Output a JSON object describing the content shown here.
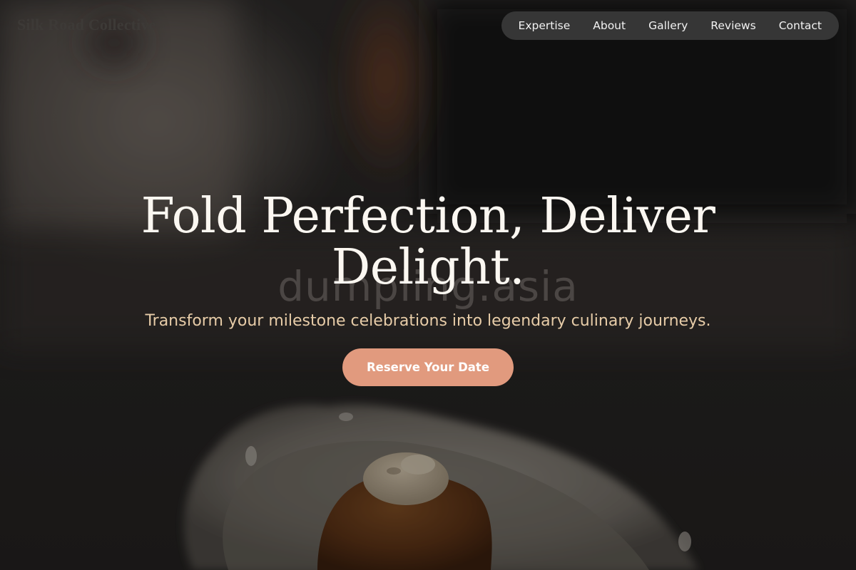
{
  "brand": {
    "name": "Silk Road Collective"
  },
  "nav": {
    "items": [
      "Expertise",
      "About",
      "Gallery",
      "Reviews",
      "Contact"
    ]
  },
  "hero": {
    "headline": "Fold Perfection, Deliver Delight.",
    "subheadline": "Transform your milestone celebrations into legendary culinary journeys.",
    "cta_label": "Reserve Your Date",
    "watermark": "dumpling.asia"
  },
  "colors": {
    "nav_bg": "#3a3a3a",
    "headline": "#fbf7f1",
    "subheadline": "#e7cca8",
    "cta_bg": "#e19a7e",
    "cta_text": "#ffffff",
    "logo": "#3d3a37"
  }
}
